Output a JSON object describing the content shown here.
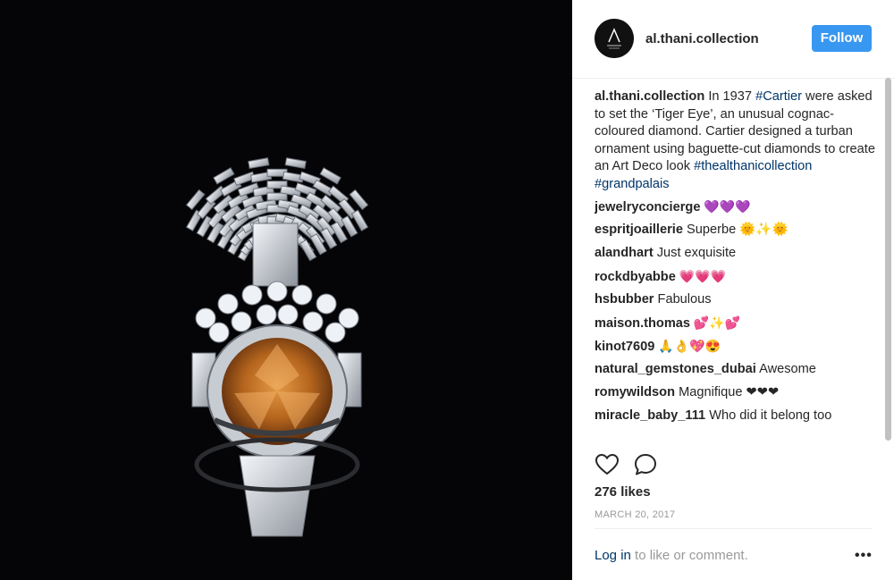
{
  "post": {
    "image_alt": "Cartier turban ornament with Tiger Eye cognac diamond",
    "colors": {
      "background": "#050507",
      "platinum": "#d9dde3",
      "cognac": "#b5651d"
    }
  },
  "header": {
    "username": "al.thani.collection",
    "follow_label": "Follow",
    "accent": "#3897f0"
  },
  "caption": {
    "username": "al.thani.collection",
    "text_parts": [
      {
        "type": "text",
        "value": " In 1937 "
      },
      {
        "type": "tag",
        "value": "#Cartier"
      },
      {
        "type": "text",
        "value": " were asked to set the ‘Tiger Eye’, an unusual cognac-coloured diamond. Cartier designed a turban ornament using baguette-cut diamonds to create an Art Deco look "
      },
      {
        "type": "tag",
        "value": "#thealthanicollection"
      },
      {
        "type": "text",
        "value": " "
      },
      {
        "type": "tag",
        "value": "#grandpalais"
      }
    ]
  },
  "comments": [
    {
      "username": "jewelryconcierge",
      "text": " 💜💜💜"
    },
    {
      "username": "espritjoaillerie",
      "text": " Superbe 🌞✨🌞"
    },
    {
      "username": "alandhart",
      "text": " Just exquisite"
    },
    {
      "username": "rockdbyabbe",
      "text": " 💗💗💗"
    },
    {
      "username": "hsbubber",
      "text": " Fabulous"
    },
    {
      "username": "maison.thomas",
      "text": " 💕✨💕"
    },
    {
      "username": "kinot7609",
      "text": " 🙏👌💖😍"
    },
    {
      "username": "natural_gemstones_dubai",
      "text": " Awesome"
    },
    {
      "username": "romywildson",
      "text": " Magnifique ❤❤❤"
    },
    {
      "username": "miracle_baby_111",
      "text": " Who did it belong too"
    }
  ],
  "actions": {
    "like_icon": "heart-icon",
    "comment_icon": "comment-bubble-icon"
  },
  "likes": "276 likes",
  "date": "MARCH 20, 2017",
  "footer": {
    "login_label": "Log in",
    "prompt": " to like or comment.",
    "more_label": "•••"
  }
}
